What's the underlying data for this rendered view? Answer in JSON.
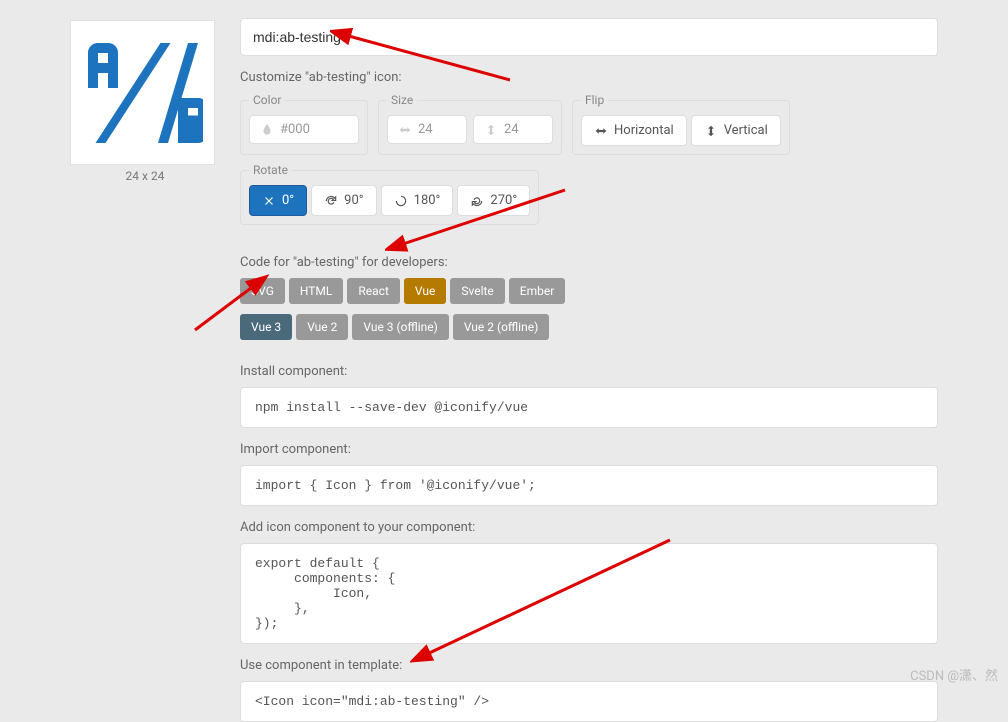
{
  "icon": {
    "name": "mdi:ab-testing",
    "dims": "24 x 24"
  },
  "customize_label": "Customize \"ab-testing\" icon:",
  "color": {
    "legend": "Color",
    "value": "#000"
  },
  "size": {
    "legend": "Size",
    "width": "24",
    "height": "24"
  },
  "flip": {
    "legend": "Flip",
    "horizontal": "Horizontal",
    "vertical": "Vertical"
  },
  "rotate": {
    "legend": "Rotate",
    "options": [
      "0°",
      "90°",
      "180°",
      "270°"
    ]
  },
  "code_label": "Code for \"ab-testing\" for developers:",
  "frameworks": [
    "SVG",
    "HTML",
    "React",
    "Vue",
    "Svelte",
    "Ember"
  ],
  "frameworks_active": 3,
  "vue_versions": [
    "Vue 3",
    "Vue 2",
    "Vue 3 (offline)",
    "Vue 2 (offline)"
  ],
  "vue_versions_active": 0,
  "install": {
    "label": "Install component:",
    "code": "npm install --save-dev @iconify/vue"
  },
  "import": {
    "label": "Import component:",
    "code": "import { Icon } from '@iconify/vue';"
  },
  "add": {
    "label": "Add icon component to your component:",
    "code": "export default {\n     components: {\n          Icon,\n     },\n});"
  },
  "use": {
    "label": "Use component in template:",
    "code": "<Icon icon=\"mdi:ab-testing\" />"
  },
  "watermark": "CSDN @潇、然"
}
